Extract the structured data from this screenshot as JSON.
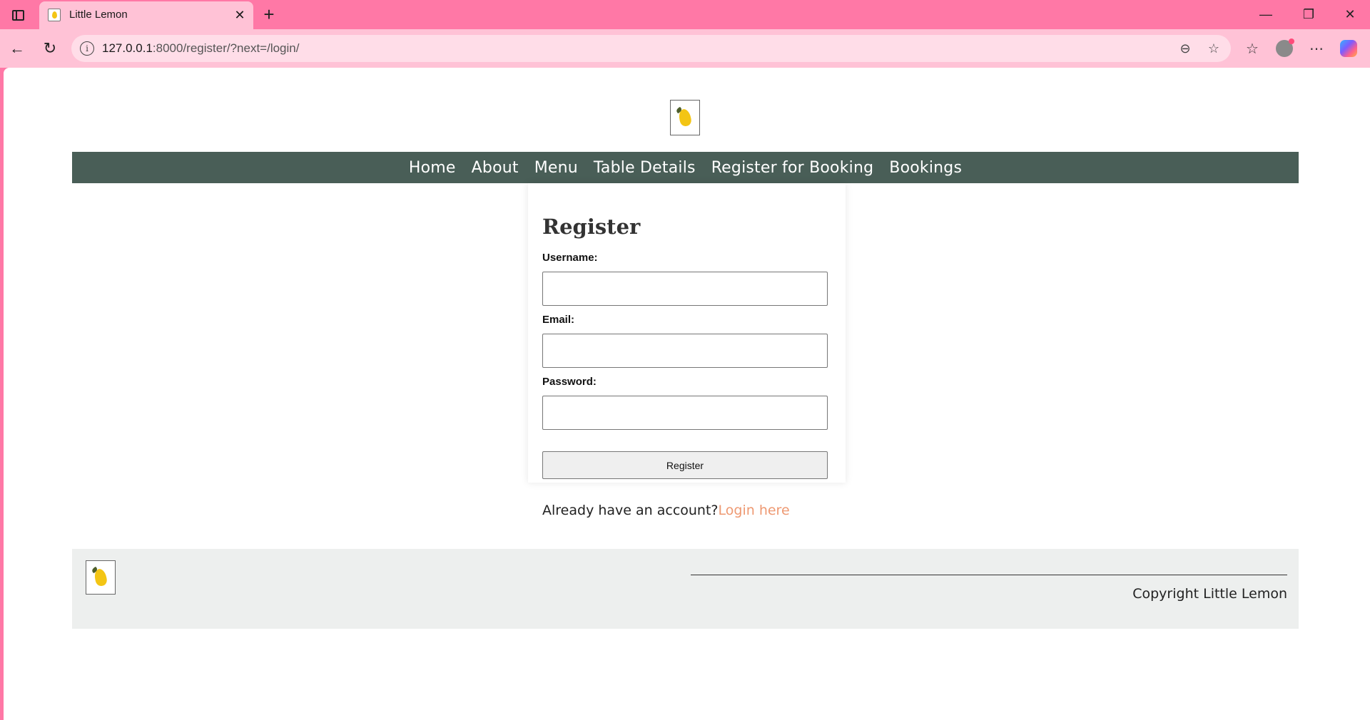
{
  "browser": {
    "tab": {
      "title": "Little Lemon",
      "close_glyph": "✕"
    },
    "new_tab_glyph": "+",
    "window": {
      "minimize": "—",
      "restore": "❐",
      "close": "✕"
    },
    "nav": {
      "back": "←",
      "reload": "↻"
    },
    "address": {
      "host": "127.0.0.1",
      "path": ":8000/register/?next=/login/",
      "info_glyph": "i"
    },
    "icons": {
      "zoom": "⊖",
      "favorite": "☆",
      "favorites": "☆",
      "more": "⋯"
    }
  },
  "site": {
    "nav": [
      "Home",
      "About",
      "Menu",
      "Table Details",
      "Register for Booking",
      "Bookings"
    ],
    "form": {
      "title": "Register",
      "username_label": "Username:",
      "email_label": "Email:",
      "password_label": "Password:",
      "username_value": "",
      "email_value": "",
      "password_value": "",
      "submit_label": "Register"
    },
    "login_prompt": {
      "text": "Already have an account?",
      "link": "Login here"
    },
    "footer": {
      "copyright": "Copyright Little Lemon"
    }
  },
  "colors": {
    "browser_frame": "#ff78a6",
    "browser_toolbar": "#ffc2d6",
    "nav_background": "#495e57",
    "footer_background": "#edefee",
    "link": "#ee9972",
    "logo_lemon": "#f3c514"
  }
}
